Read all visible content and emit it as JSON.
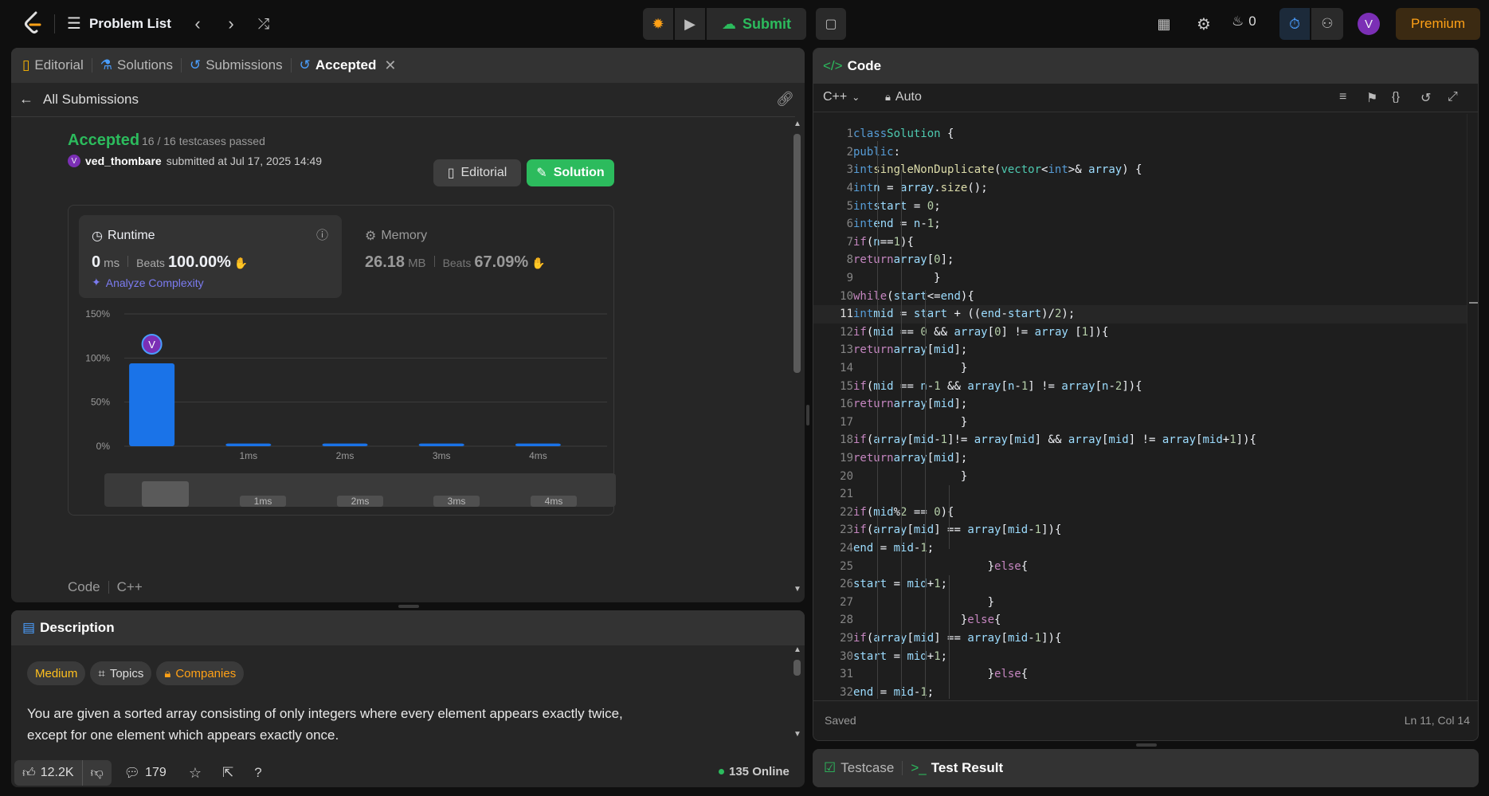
{
  "topbar": {
    "problem_list": "Problem List",
    "submit": "Submit",
    "streak": "0",
    "avatar": "V",
    "premium": "Premium"
  },
  "left": {
    "tabs": [
      {
        "label": "Editorial"
      },
      {
        "label": "Solutions"
      },
      {
        "label": "Submissions"
      },
      {
        "label": "Accepted"
      }
    ],
    "back": "All Submissions",
    "status": "Accepted",
    "cases": "16 / 16 testcases passed",
    "user": "ved_thombare",
    "submitted": "submitted at Jul 17, 2025 14:49",
    "user_initial": "V",
    "btn_editorial": "Editorial",
    "btn_solution": "Solution",
    "runtime": {
      "title": "Runtime",
      "value": "0",
      "unit": "ms",
      "beats_label": "Beats",
      "beats": "100.00%",
      "analyze": "Analyze Complexity"
    },
    "memory": {
      "title": "Memory",
      "value": "26.18",
      "unit": "MB",
      "beats_label": "Beats",
      "beats": "67.09%"
    },
    "footer_code": "Code",
    "footer_lang": "C++"
  },
  "chart_data": {
    "type": "bar",
    "categories": [
      "0ms",
      "1ms",
      "2ms",
      "3ms",
      "4ms"
    ],
    "tick_labels": [
      "",
      "1ms",
      "2ms",
      "3ms",
      "4ms"
    ],
    "values": [
      94,
      3,
      3,
      3,
      3
    ],
    "ylim": [
      0,
      150
    ],
    "yticks": [
      "150%",
      "100%",
      "50%",
      "0%"
    ],
    "marker": "V",
    "colors": {
      "bar": "#1a73e8",
      "grid": "#3e3e3e"
    }
  },
  "desc": {
    "title": "Description",
    "difficulty": "Medium",
    "topics": "Topics",
    "companies": "Companies",
    "text": "You are given a sorted array consisting of only integers where every element appears exactly twice, except for one element which appears exactly once.",
    "likes": "12.2K",
    "comments": "179",
    "online": "135 Online"
  },
  "code": {
    "title": "Code",
    "lang": "C++",
    "mode": "Auto",
    "saved": "Saved",
    "position": "Ln 11, Col 14",
    "current_line": 11
  },
  "test": {
    "testcase": "Testcase",
    "result": "Test Result"
  }
}
